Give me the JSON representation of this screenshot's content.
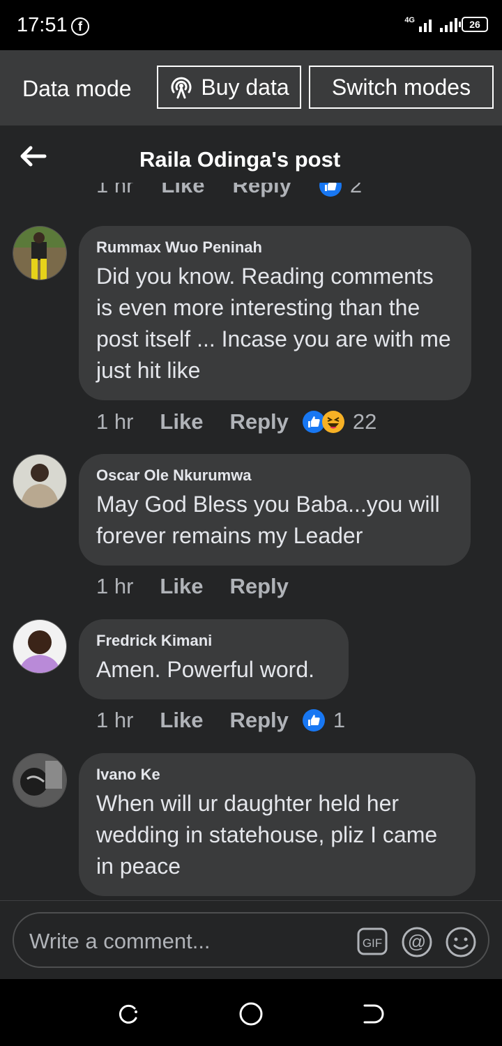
{
  "status_bar": {
    "time": "17:51",
    "network": "4G",
    "battery": "26"
  },
  "data_mode": {
    "label": "Data mode",
    "buy_label": "Buy data",
    "switch_label": "Switch modes"
  },
  "header": {
    "title": "Raila Odinga's post"
  },
  "partial_row": {
    "time": "1 hr",
    "like": "Like",
    "reply": "Reply",
    "count": "2"
  },
  "comments": [
    {
      "author": "Rummax Wuo Peninah",
      "text": "Did you know. Reading comments is even more interesting than the post itself ... Incase you are with me just hit like",
      "time": "1 hr",
      "like": "Like",
      "reply": "Reply",
      "reactions": [
        "like",
        "haha"
      ],
      "count": "22"
    },
    {
      "author": "Oscar Ole Nkurumwa",
      "text": "May God Bless you Baba...you will forever remains my Leader",
      "time": "1 hr",
      "like": "Like",
      "reply": "Reply"
    },
    {
      "author": "Fredrick Kimani",
      "text": "Amen. Powerful word.",
      "time": "1 hr",
      "like": "Like",
      "reply": "Reply",
      "reactions": [
        "like"
      ],
      "count": "1"
    },
    {
      "author": "Ivano Ke",
      "text": "When will ur daughter held her wedding in statehouse, pliz I came in peace"
    }
  ],
  "composer": {
    "placeholder": "Write a comment..."
  },
  "colors": {
    "background": "#242526",
    "bubble": "#3a3b3c",
    "like_blue": "#1877f2",
    "haha_yellow": "#f7b125"
  }
}
